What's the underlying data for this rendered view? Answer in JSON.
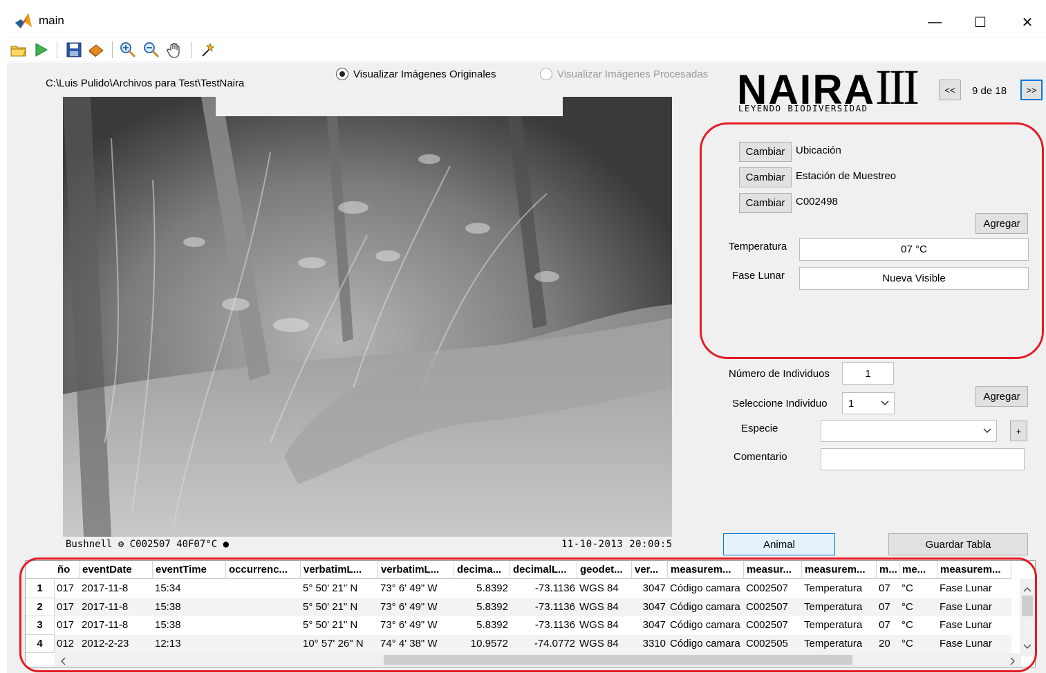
{
  "window": {
    "title": "main",
    "minimize": "—",
    "maximize": "☐",
    "close": "✕"
  },
  "toolbar": {
    "icons": [
      "open-folder-icon",
      "run-icon",
      "save-icon",
      "print-icon",
      "zoom-in-icon",
      "zoom-out-icon",
      "pan-hand-icon",
      "data-cursor-icon"
    ]
  },
  "path": "C:\\Luis Pulido\\Archivos para Test\\TestNaira",
  "view": {
    "original_label": "Visualizar Imágenes Originales",
    "processed_label": "Visualizar Imágenes Procesadas",
    "selected": "original"
  },
  "photo": {
    "footer_left": "Bushnell  ⚙ C002507   40F07°C ●",
    "footer_right": "11-10-2013  20:00:5"
  },
  "logo": {
    "title": "NAIRA",
    "suffix": "III",
    "subtitle": "LEYENDO BIODIVERSIDAD"
  },
  "nav": {
    "prev": "<<",
    "next": ">>",
    "counter": "9 de 18"
  },
  "meta": {
    "change_label": "Cambiar",
    "rows": [
      {
        "value": "Ubicación"
      },
      {
        "value": "Estación de Muestreo"
      },
      {
        "value": "C002498"
      }
    ],
    "add_label": "Agregar",
    "temperature_label": "Temperatura",
    "temperature_value": "07 °C",
    "moon_label": "Fase Lunar",
    "moon_value": "Nueva Visible"
  },
  "individuals": {
    "count_label": "Número de Individuos",
    "count_value": "1",
    "select_label": "Seleccione Individuo",
    "select_value": "1",
    "add_label": "Agregar",
    "species_label": "Especie",
    "species_value": "",
    "plus_label": "+",
    "comment_label": "Comentario",
    "comment_value": ""
  },
  "actions": {
    "animal": "Animal",
    "save_table": "Guardar Tabla"
  },
  "table": {
    "columns": [
      "ño",
      "eventDate",
      "eventTime",
      "occurrenc...",
      "verbatimL...",
      "verbatimL...",
      "decima...",
      "decimalL...",
      "geodet...",
      "ver...",
      "measurem...",
      "measur...",
      "measurem...",
      "m...",
      "me...",
      "measurem..."
    ],
    "rows": [
      {
        "id": "1",
        "cells": [
          "017",
          "2017-11-8",
          "15:34",
          "",
          "5° 50' 21\" N",
          "73° 6' 49\" W",
          "5.8392",
          "-73.1136",
          "WGS 84",
          "3047",
          "Código camara",
          "C002507",
          "Temperatura",
          "07",
          "°C",
          "Fase Lunar"
        ]
      },
      {
        "id": "2",
        "cells": [
          "017",
          "2017-11-8",
          "15:38",
          "",
          "5° 50' 21\" N",
          "73° 6' 49\" W",
          "5.8392",
          "-73.1136",
          "WGS 84",
          "3047",
          "Código camara",
          "C002507",
          "Temperatura",
          "07",
          "°C",
          "Fase Lunar"
        ]
      },
      {
        "id": "3",
        "cells": [
          "017",
          "2017-11-8",
          "15:38",
          "",
          "5° 50' 21\" N",
          "73° 6' 49\" W",
          "5.8392",
          "-73.1136",
          "WGS 84",
          "3047",
          "Código camara",
          "C002507",
          "Temperatura",
          "07",
          "°C",
          "Fase Lunar"
        ]
      },
      {
        "id": "4",
        "cells": [
          "012",
          "2012-2-23",
          "12:13",
          "",
          "10° 57' 26\" N",
          "74° 4' 38\" W",
          "10.9572",
          "-74.0772",
          "WGS 84",
          "3310",
          "Código camara",
          "C002505",
          "Temperatura",
          "20",
          "°C",
          "Fase Lunar"
        ]
      }
    ]
  },
  "colors": {
    "highlight": "#e31b23",
    "focus": "#0078d7",
    "panel_bg": "#f0f0f0"
  }
}
